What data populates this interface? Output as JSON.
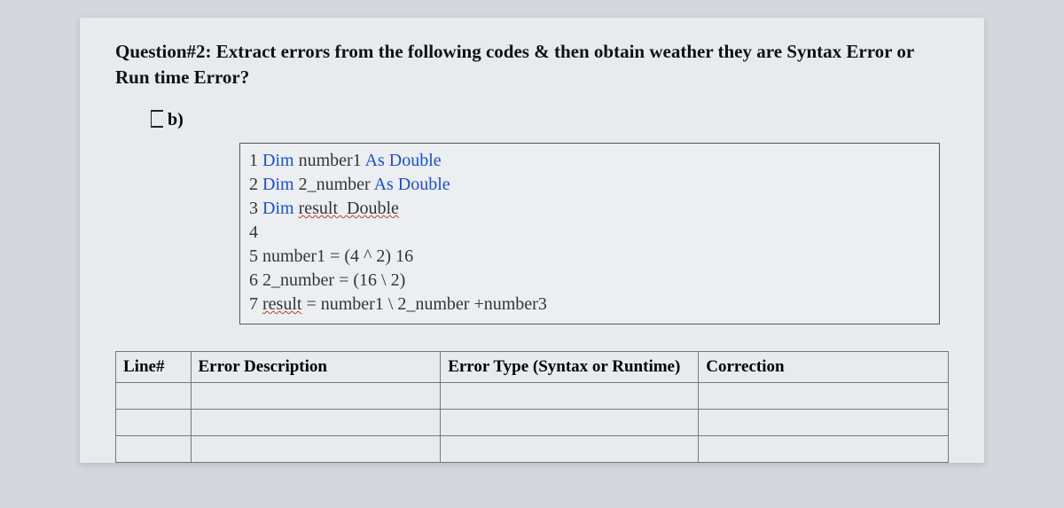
{
  "question": {
    "label": "Question#2:",
    "text": "Extract errors from the following codes & then obtain weather they are Syntax Error or Run time Error?"
  },
  "part": {
    "label": "b)"
  },
  "code": {
    "lines": [
      {
        "n": "1",
        "segments": [
          {
            "t": "Dim ",
            "c": "kw"
          },
          {
            "t": "number1 ",
            "c": "nm"
          },
          {
            "t": "As Double",
            "c": "kw"
          }
        ]
      },
      {
        "n": "2",
        "segments": [
          {
            "t": "Dim ",
            "c": "kw"
          },
          {
            "t": "2_number ",
            "c": "nm"
          },
          {
            "t": "As Double",
            "c": "kw"
          }
        ]
      },
      {
        "n": "3",
        "segments": [
          {
            "t": "Dim ",
            "c": "kw"
          },
          {
            "t": "result  Double",
            "c": "nm wavy"
          }
        ]
      },
      {
        "n": "4",
        "segments": []
      },
      {
        "n": "5",
        "segments": [
          {
            "t": "number1 = (4 ^ 2) 16",
            "c": "nm"
          }
        ]
      },
      {
        "n": "6",
        "segments": [
          {
            "t": "2_number = (16 \\ 2)",
            "c": "nm"
          }
        ]
      },
      {
        "n": "7",
        "segments": [
          {
            "t": "result",
            "c": "nm wavy"
          },
          {
            "t": " = number1 \\ 2_number +number3",
            "c": "nm"
          }
        ]
      }
    ]
  },
  "table": {
    "headers": {
      "line": "Line#",
      "desc": "Error Description",
      "type": "Error Type (Syntax or Runtime)",
      "corr": "Correction"
    },
    "rows": [
      {
        "line": "",
        "desc": "",
        "type": "",
        "corr": ""
      },
      {
        "line": "",
        "desc": "",
        "type": "",
        "corr": ""
      },
      {
        "line": "",
        "desc": "",
        "type": "",
        "corr": ""
      }
    ]
  }
}
